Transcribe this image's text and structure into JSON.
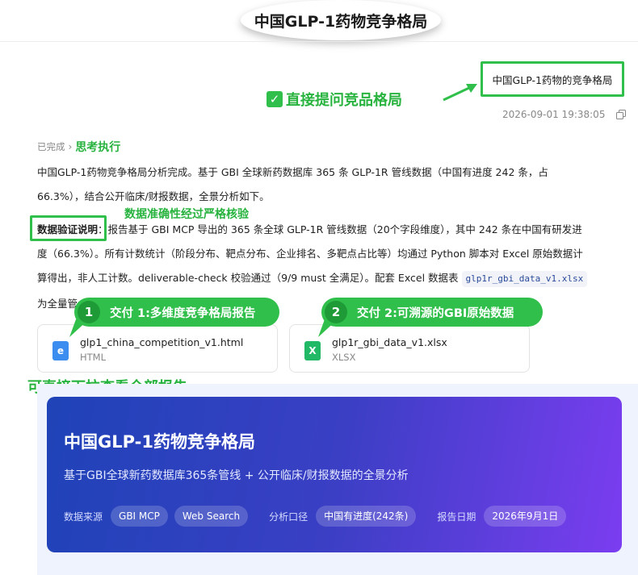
{
  "page_title": "中国GLP-1药物竞争格局",
  "user_question": "中国GLP-1药物的竞争格局",
  "annotations": {
    "ask_direct": "直接提问竞品格局",
    "data_accuracy": "数据准确性经过严格核验",
    "delivery1_num": "1",
    "delivery1": "交付 1:多维度竞争格局报告",
    "delivery2_num": "2",
    "delivery2": "交付 2:可溯源的GBI原始数据",
    "drag_view": "可直接下拉查看全部报告"
  },
  "message": {
    "timestamp": "2026-09-01 19:38:05",
    "status": "已完成",
    "thinking": "思考执行",
    "p1": "中国GLP-1药物竞争格局分析完成。基于 GBI 全球新药数据库 365 条 GLP-1R 管线数据（中国有进度 242 条，占",
    "p2": "66.3%），结合公开临床/财报数据，全景分析如下。",
    "verify_label": "数据验证说明",
    "p3_rest": "：报告基于 GBI MCP 导出的 365 条全球 GLP-1R 管线数据（20个字段维度），其中 242 条在中国有研发进",
    "p4": "度（66.3%）。所有计数统计（阶段分布、靶点分布、企业排名、多靶点占比等）均通过 Python 脚本对 Excel 原始数据计",
    "p5": "算得出，非人工计数。deliverable-check 校验通过（9/9 must 全满足）。配套 Excel 数据表 ",
    "p5_code": "glp1r_gbi_data_v1.xlsx",
    "p6": "为全量管"
  },
  "files": [
    {
      "name": "glp1_china_competition_v1.html",
      "type": "HTML",
      "icon_letter": "e"
    },
    {
      "name": "glp1r_gbi_data_v1.xlsx",
      "type": "XLSX",
      "icon_letter": "X"
    }
  ],
  "report": {
    "title": "中国GLP-1药物竞争格局",
    "subtitle": "基于GBI全球新药数据库365条管线 + 公开临床/财报数据的全景分析",
    "source_label": "数据来源",
    "source_chips": [
      "GBI MCP",
      "Web Search"
    ],
    "scope_label": "分析口径",
    "scope_chip": "中国有进度(242条)",
    "date_label": "报告日期",
    "date_chip": "2026年9月1日"
  },
  "colors": {
    "annotation_green": "#2fbf4a",
    "report_gradient_start": "#1f43b8",
    "report_gradient_end": "#7b3df0"
  }
}
